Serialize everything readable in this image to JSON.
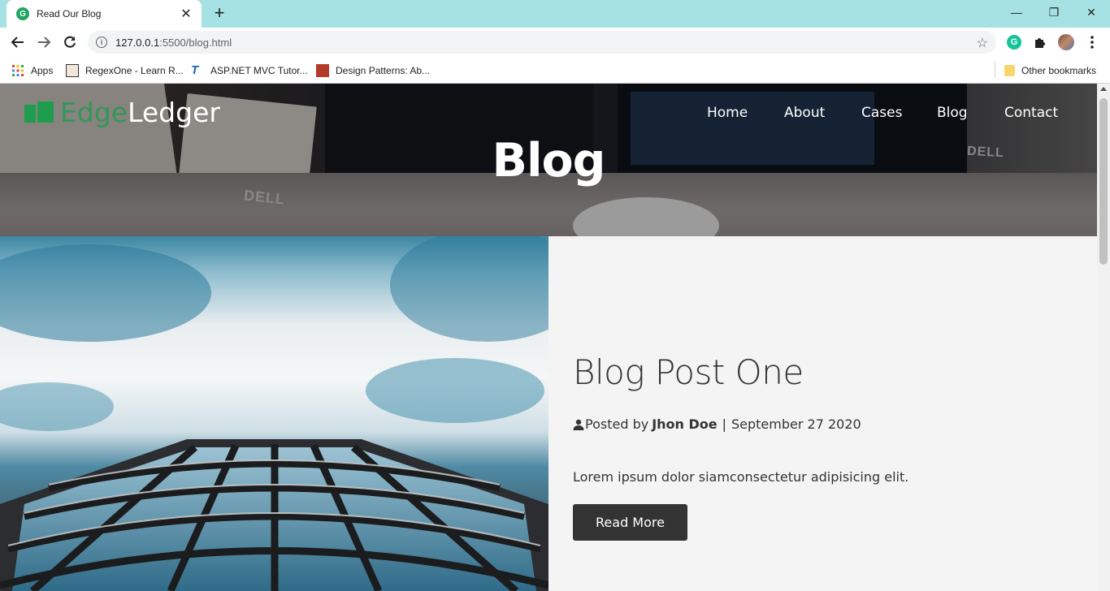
{
  "browser": {
    "tab_title": "Read Our Blog",
    "tab_close": "✕",
    "new_tab": "+",
    "url_host": "127.0.0.1",
    "url_rest": ":5500/blog.html",
    "bookmarks": [
      {
        "label": "Apps"
      },
      {
        "label": "RegexOne - Learn R..."
      },
      {
        "label": "ASP.NET MVC Tutor..."
      },
      {
        "label": "Design Patterns: Ab..."
      }
    ],
    "other_bookmarks": "Other bookmarks",
    "window_controls": {
      "minimize": "—",
      "restore": "❐",
      "close": "✕"
    }
  },
  "site": {
    "logo_edge": "Edge",
    "logo_ledger": "Ledger",
    "nav": [
      "Home",
      "About",
      "Cases",
      "Blog",
      "Contact"
    ],
    "hero_title": "Blog",
    "hero_decor": {
      "dell_left": "DELL",
      "dell_right": "DELL"
    }
  },
  "post": {
    "title": "Blog Post One",
    "posted_by": "Posted by",
    "author": "Jhon Doe",
    "separator": "|",
    "date": "September 27 2020",
    "excerpt": "Lorem ipsum dolor siamconsectetur adipisicing elit.",
    "read_more": "Read More"
  },
  "colors": {
    "tabstrip": "#a6e1e3",
    "brand_green": "#1f9d4f",
    "button_dark": "#333333",
    "panel_bg": "#f4f4f4"
  }
}
